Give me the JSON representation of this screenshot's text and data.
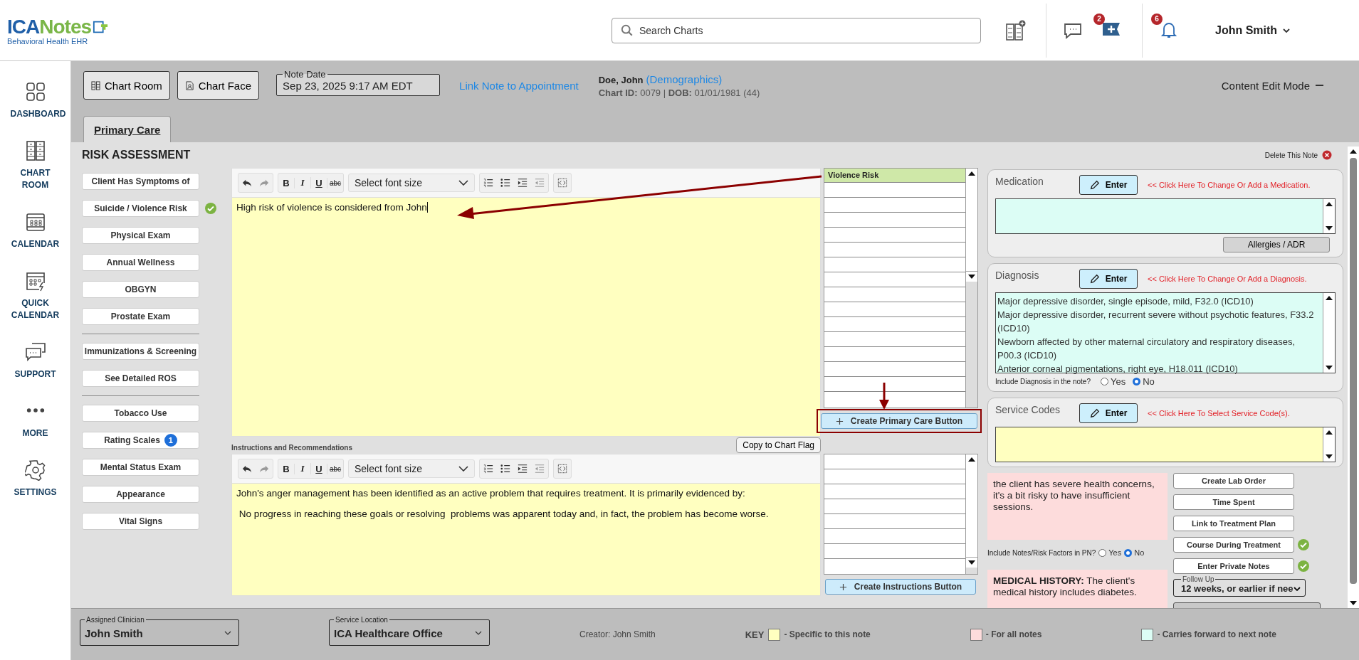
{
  "topbar": {
    "logo": {
      "brand_first": "ICA",
      "brand_second": "Notes",
      "tagline": "Behavioral Health EHR"
    },
    "search": {
      "placeholder": "Search Charts"
    },
    "message_count": "2",
    "notification_count": "6",
    "user_name": "John Smith"
  },
  "nav": [
    {
      "label": "DASHBOARD"
    },
    {
      "label": "CHART ROOM"
    },
    {
      "label": "CALENDAR"
    },
    {
      "label": "QUICK CALENDAR"
    },
    {
      "label": "SUPPORT"
    },
    {
      "label": "MORE"
    },
    {
      "label": "SETTINGS"
    }
  ],
  "chart_header": {
    "buttons": [
      "Chart Room",
      "Chart Face"
    ],
    "note_date": {
      "label": "Note Date",
      "value": "Sep 23, 2025 9:17 AM EDT"
    },
    "appointment_link": "Link Note to Appointment",
    "patient": {
      "name": "Doe, John",
      "demographics_link": "(Demographics)",
      "details": "**Chart ID:** 0079 | **DOB:** 01/01/1981 (44)"
    },
    "mode": "Content Edit Mode"
  },
  "tabs": [
    {
      "label": "Primary Care",
      "selected": true
    }
  ],
  "section": {
    "title": "RISK ASSESSMENT",
    "delete_label": "Delete This Note"
  },
  "section_buttons": [
    [
      {
        "label": "Client Has Symptoms of",
        "completed": false
      },
      {
        "label": "Suicide / Violence Risk",
        "completed": true
      },
      {
        "label": "Physical Exam",
        "completed": false
      },
      {
        "label": "Annual Wellness",
        "completed": false
      },
      {
        "label": "OBGYN",
        "completed": false
      },
      {
        "label": "Prostate Exam",
        "completed": false
      }
    ],
    [
      {
        "label": "Immunizations & Screening",
        "completed": false
      },
      {
        "label": "See Detailed ROS",
        "completed": false
      }
    ],
    [
      {
        "label": "Tobacco Use",
        "completed": false
      },
      {
        "label": "Rating Scales",
        "completed": false,
        "badge": "1"
      },
      {
        "label": "Mental Status Exam",
        "completed": false
      },
      {
        "label": "Appearance",
        "completed": false
      },
      {
        "label": "Vital Signs",
        "completed": false
      }
    ]
  ],
  "note_editor": {
    "format_buttons": [
      "B",
      "I",
      "U",
      "abc"
    ],
    "font_size_placeholder": "Select font size",
    "paragraphs": [
      "High risk of violence is considered from John"
    ]
  },
  "note_list": {
    "items": [
      {
        "label": "Violence Risk",
        "selected": true
      }
    ],
    "create_button": "Create Primary Care Button"
  },
  "instructions": {
    "label": "Instructions and Recommendations",
    "copy_button": "Copy to Chart Flag",
    "format_buttons": [
      "B",
      "I",
      "U",
      "abc"
    ],
    "font_size_placeholder": "Select font size",
    "paragraphs": [
      "John's anger management has been identified as an active problem that requires treatment. It is primarily evidenced by:",
      " No progress in reaching these goals or resolving  problems was apparent today and, in fact, the problem has become worse."
    ]
  },
  "instructions_list": {
    "create_button": "Create Instructions Button"
  },
  "medication": {
    "title": "Medication",
    "enter_button": "Enter",
    "hint": "<< Click Here To Change Or Add a Medication.",
    "extra_button": "Allergies / ADR"
  },
  "diagnosis": {
    "title": "Diagnosis",
    "enter_button": "Enter",
    "hint": "<< Click Here To Change Or Add a Diagnosis.",
    "items": [
      "Major depressive disorder, single episode, mild, F32.0 (ICD10)",
      "Major depressive disorder, recurrent severe without psychotic features, F33.2 (ICD10)",
      "Newborn affected by other maternal circulatory and respiratory diseases, P00.3 (ICD10)",
      "Anterior corneal pigmentations, right eye, H18.011 (ICD10)"
    ],
    "include_question": "Include Diagnosis in the note?",
    "options": [
      {
        "label": "Yes",
        "selected": false
      },
      {
        "label": "No",
        "selected": true
      }
    ]
  },
  "service_codes": {
    "title": "Service Codes",
    "enter_button": "Enter",
    "hint": "<< Click Here To Select Service Code(s)."
  },
  "risk_notes": {
    "text": "the client has severe health concerns, it's a bit risky to have insufficient sessions.",
    "include_question": "Include Notes/Risk Factors in PN?",
    "options": [
      {
        "label": "Yes",
        "selected": false
      },
      {
        "label": "No",
        "selected": true
      }
    ]
  },
  "medical_history": {
    "text": "**MEDICAL HISTORY:** The client's medical history includes diabetes."
  },
  "actions": [
    {
      "label": "Create Lab Order",
      "completed": false
    },
    {
      "label": "Time Spent",
      "completed": false
    },
    {
      "label": "Link to Treatment Plan",
      "completed": false
    },
    {
      "label": "Course During Treatment",
      "completed": true
    },
    {
      "label": "Enter Private Notes",
      "completed": true
    }
  ],
  "follow_up": {
    "label": "Follow Up",
    "value": "12 weeks, or earlier if nee"
  },
  "footer": {
    "clinician": {
      "label": "Assigned Clinician",
      "value": "John Smith"
    },
    "location": {
      "label": "Service Location",
      "value": "ICA Healthcare Office"
    },
    "creator": "Creator: John Smith",
    "key_label": "KEY",
    "key": [
      {
        "label": "- Specific to this note",
        "color": "#ffffc0"
      },
      {
        "label": "- For all notes",
        "color": "#fddcdc"
      },
      {
        "label": "- Carries forward to next note",
        "color": "#dcfdf5"
      }
    ]
  }
}
